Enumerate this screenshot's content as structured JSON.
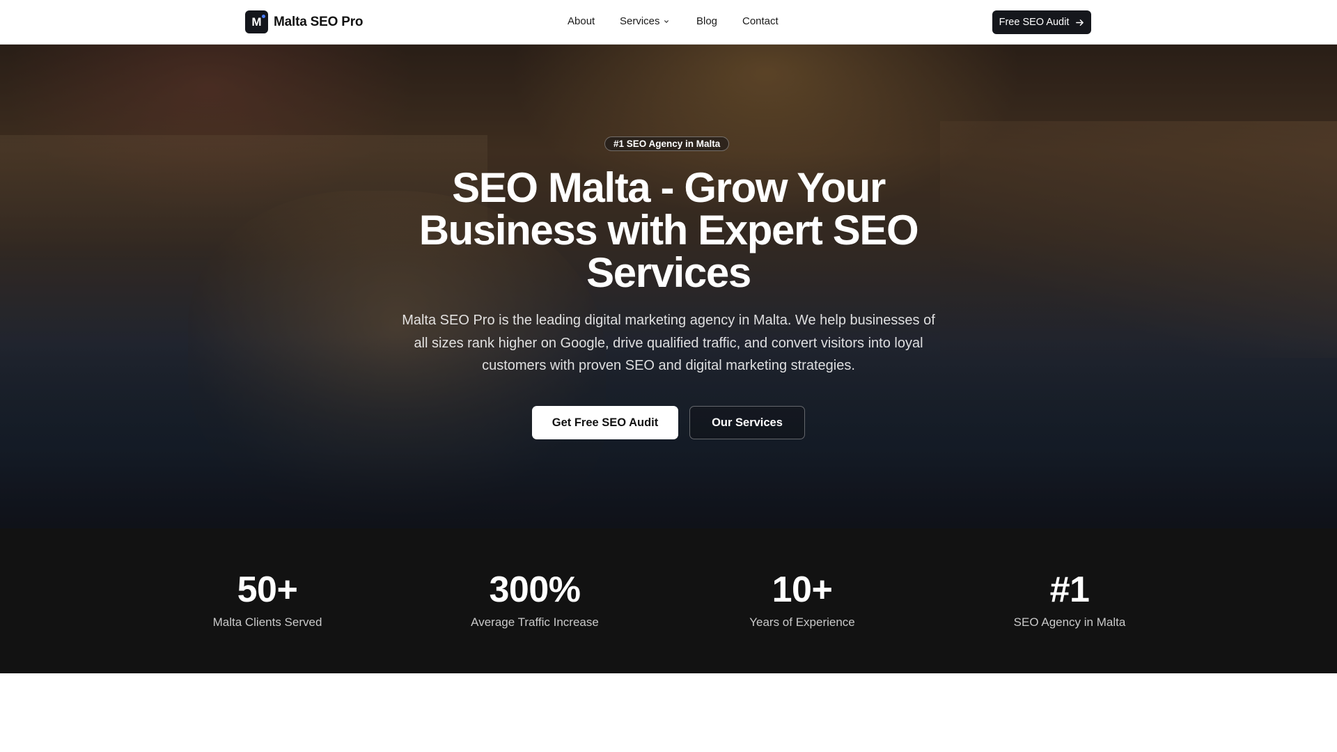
{
  "header": {
    "brand": {
      "logo_letter": "M",
      "name": "Malta SEO Pro"
    },
    "nav": {
      "about": "About",
      "services": "Services",
      "blog": "Blog",
      "contact": "Contact"
    },
    "cta": {
      "label": "Free SEO Audit",
      "icon": "arrow-right-icon"
    }
  },
  "hero": {
    "badge": "#1 SEO Agency in Malta",
    "title": "SEO Malta - Grow Your Business with Expert SEO Services",
    "description": "Malta SEO Pro is the leading digital marketing agency in Malta. We help businesses of all sizes rank higher on Google, drive qualified traffic, and convert visitors into loyal customers with proven SEO and digital marketing strategies.",
    "primary_button": "Get Free SEO Audit",
    "secondary_button": "Our Services"
  },
  "stats": [
    {
      "value": "50+",
      "label": "Malta Clients Served"
    },
    {
      "value": "300%",
      "label": "Average Traffic Increase"
    },
    {
      "value": "10+",
      "label": "Years of Experience"
    },
    {
      "value": "#1",
      "label": "SEO Agency in Malta"
    }
  ],
  "colors": {
    "header_bg": "#ffffff",
    "cta_bg": "#15171c",
    "stats_bg": "#121212",
    "text_dark": "#111111",
    "text_light": "#ffffff"
  }
}
